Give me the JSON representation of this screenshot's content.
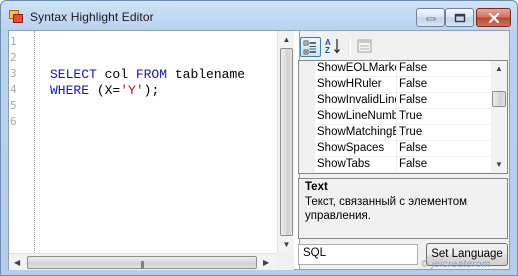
{
  "window": {
    "title": "Syntax Highlight Editor",
    "icons": {
      "app": "app-window-icon",
      "minimize": "minimize-icon",
      "maximize": "maximize-icon",
      "close": "close-icon"
    }
  },
  "editor": {
    "line_numbers": [
      "1",
      "2",
      "3",
      "4",
      "5",
      "6"
    ],
    "code_lines": [
      [
        {
          "t": "SELECT",
          "c": "kw"
        },
        {
          "t": " col "
        },
        {
          "t": "FROM",
          "c": "kw"
        },
        {
          "t": " tablename"
        }
      ],
      [
        {
          "t": "WHERE",
          "c": "kw"
        },
        {
          "t": " (X="
        },
        {
          "t": "'Y'",
          "c": "str"
        },
        {
          "t": ");"
        }
      ]
    ],
    "colors": {
      "keyword": "#1515c8",
      "string": "#c01010"
    }
  },
  "property_grid": {
    "toolbar": {
      "categorized": "categorized-icon",
      "alphabetical": "sort-alphabetical-icon",
      "property_pages": "property-pages-icon"
    },
    "rows": [
      {
        "name": "ShowEOLMarke",
        "value": "False"
      },
      {
        "name": "ShowHRuler",
        "value": "False"
      },
      {
        "name": "ShowInvalidLine",
        "value": "False"
      },
      {
        "name": "ShowLineNumbe",
        "value": "True"
      },
      {
        "name": "ShowMatchingE",
        "value": "True"
      },
      {
        "name": "ShowSpaces",
        "value": "False"
      },
      {
        "name": "ShowTabs",
        "value": "False"
      }
    ],
    "help": {
      "title": "Text",
      "description": "Текст, связанный с элементом управления."
    }
  },
  "language": {
    "value": "SQL",
    "button_label": "Set Language"
  },
  "watermark": "© jeicreaterom"
}
